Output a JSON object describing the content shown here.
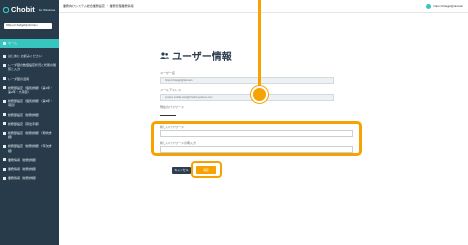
{
  "sidebar": {
    "brand": "Chobit",
    "brand_sub": "for Windows",
    "user": "https://chatgpt@domain",
    "items": [
      {
        "label": "ホーム"
      },
      {
        "label": "はじめに お読みください"
      },
      {
        "label": "レーダ図の数値設定状況と状態の閲覧と入力"
      },
      {
        "label": "レーダ図の活用"
      },
      {
        "label": "総務部設定（個別詳細）（第1年・第2年・大項目）"
      },
      {
        "label": "総務部設定（個別詳細）（第3年・項目）"
      },
      {
        "label": "総務部設定（総務詳細）"
      },
      {
        "label": "総務部設定（算出手順）"
      },
      {
        "label": "総務部設定（総務詳細）（現状詳細）"
      },
      {
        "label": "総務部設定（総務詳細）（年次詳細）"
      },
      {
        "label": "業務情報（総務詳細）"
      },
      {
        "label": "業務情報（総務詳細）"
      },
      {
        "label": "業務情報（総務詳細）"
      }
    ]
  },
  "topbar": {
    "breadcrumb": "業務向けシステム総合業務設定 ・ 業務管理業務情報",
    "user": "https://chatgpt@domain"
  },
  "form": {
    "title": "ユーザー情報",
    "username_label": "ユーザー名",
    "username_value": "https://chatgpt@domain",
    "email_label": "メールアドレス",
    "email_value": "system.mobile.web@chobit-systems.com",
    "current_pw_label": "現在のパスワード",
    "new_pw_label": "新しいパスワード",
    "confirm_pw_label": "新しいパスワードの再入力",
    "cancel_label": "キャンセル",
    "save_label": "保存"
  },
  "colors": {
    "sidebar_bg": "#273b4b",
    "active_item": "#38c4bf",
    "highlight": "#f6a200"
  }
}
